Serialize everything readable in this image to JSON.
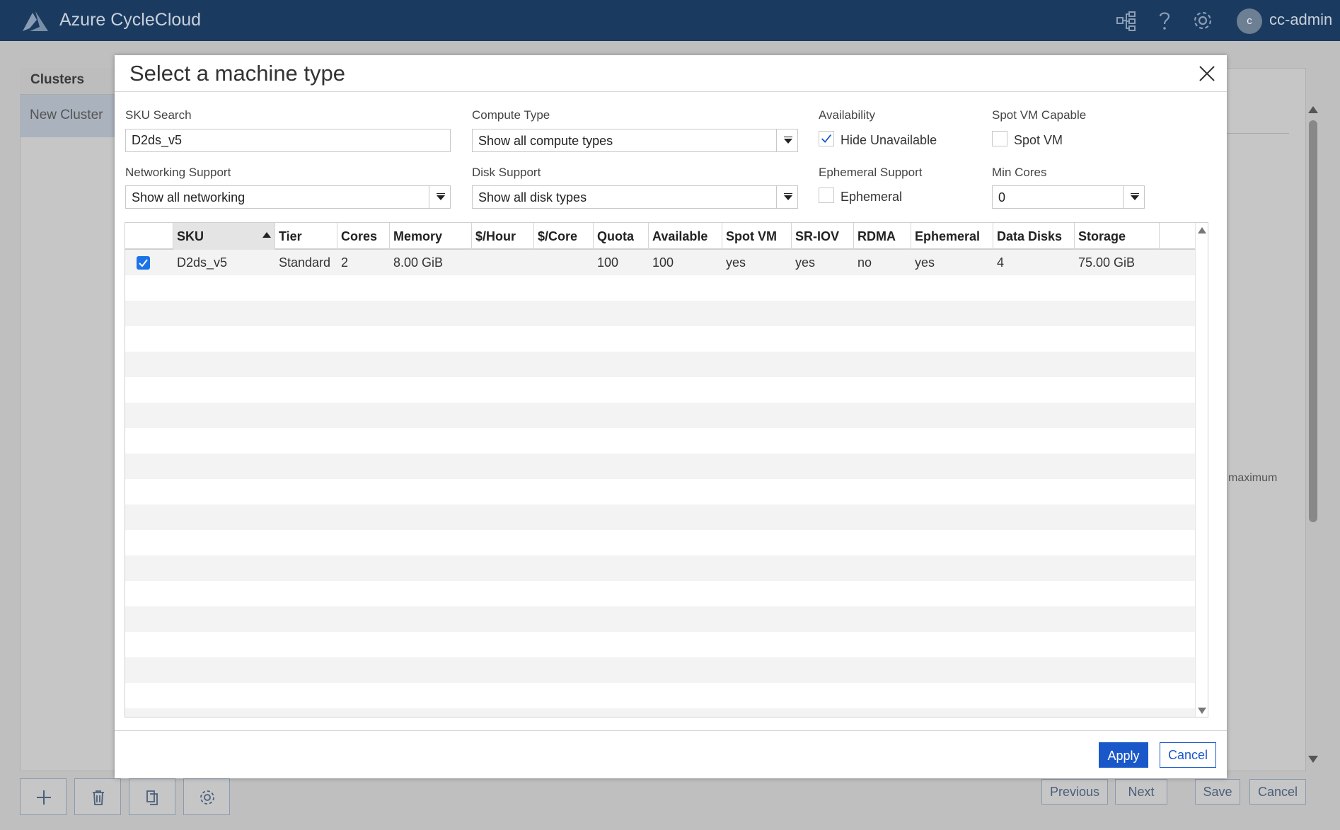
{
  "app": {
    "title": "Azure CycleCloud",
    "user_initial": "c",
    "user_name": "cc-admin"
  },
  "background": {
    "clusters_title": "Clusters",
    "new_cluster": "New Cluster",
    "maximum_text": "maximum",
    "nav_buttons": {
      "previous": "Previous",
      "next": "Next",
      "save": "Save",
      "cancel": "Cancel"
    }
  },
  "dialog": {
    "title": "Select a machine type",
    "filters": {
      "sku_search": {
        "label": "SKU Search",
        "value": "D2ds_v5"
      },
      "compute_type": {
        "label": "Compute Type",
        "value": "Show all compute types"
      },
      "availability": {
        "label": "Availability",
        "option_label": "Hide Unavailable",
        "checked": true
      },
      "spot_vm_capable": {
        "label": "Spot VM Capable",
        "option_label": "Spot VM",
        "checked": false
      },
      "networking_support": {
        "label": "Networking Support",
        "value": "Show all networking"
      },
      "disk_support": {
        "label": "Disk Support",
        "value": "Show all disk types"
      },
      "ephemeral_support": {
        "label": "Ephemeral Support",
        "option_label": "Ephemeral",
        "checked": false
      },
      "min_cores": {
        "label": "Min Cores",
        "value": "0"
      }
    },
    "table": {
      "columns": [
        "SKU",
        "Tier",
        "Cores",
        "Memory",
        "$/Hour",
        "$/Core",
        "Quota",
        "Available",
        "Spot VM",
        "SR-IOV",
        "RDMA",
        "Ephemeral",
        "Data Disks",
        "Storage"
      ],
      "rows": [
        {
          "selected": true,
          "cells": [
            "D2ds_v5",
            "Standard",
            "2",
            "8.00 GiB",
            "",
            "",
            "100",
            "100",
            "yes",
            "yes",
            "no",
            "yes",
            "4",
            "75.00 GiB"
          ]
        }
      ]
    },
    "buttons": {
      "apply": "Apply",
      "cancel": "Cancel"
    }
  },
  "colors": {
    "topbar": "#1b3a5f",
    "primary": "#1a58c9",
    "checkbox_checked": "#1b73e8"
  }
}
